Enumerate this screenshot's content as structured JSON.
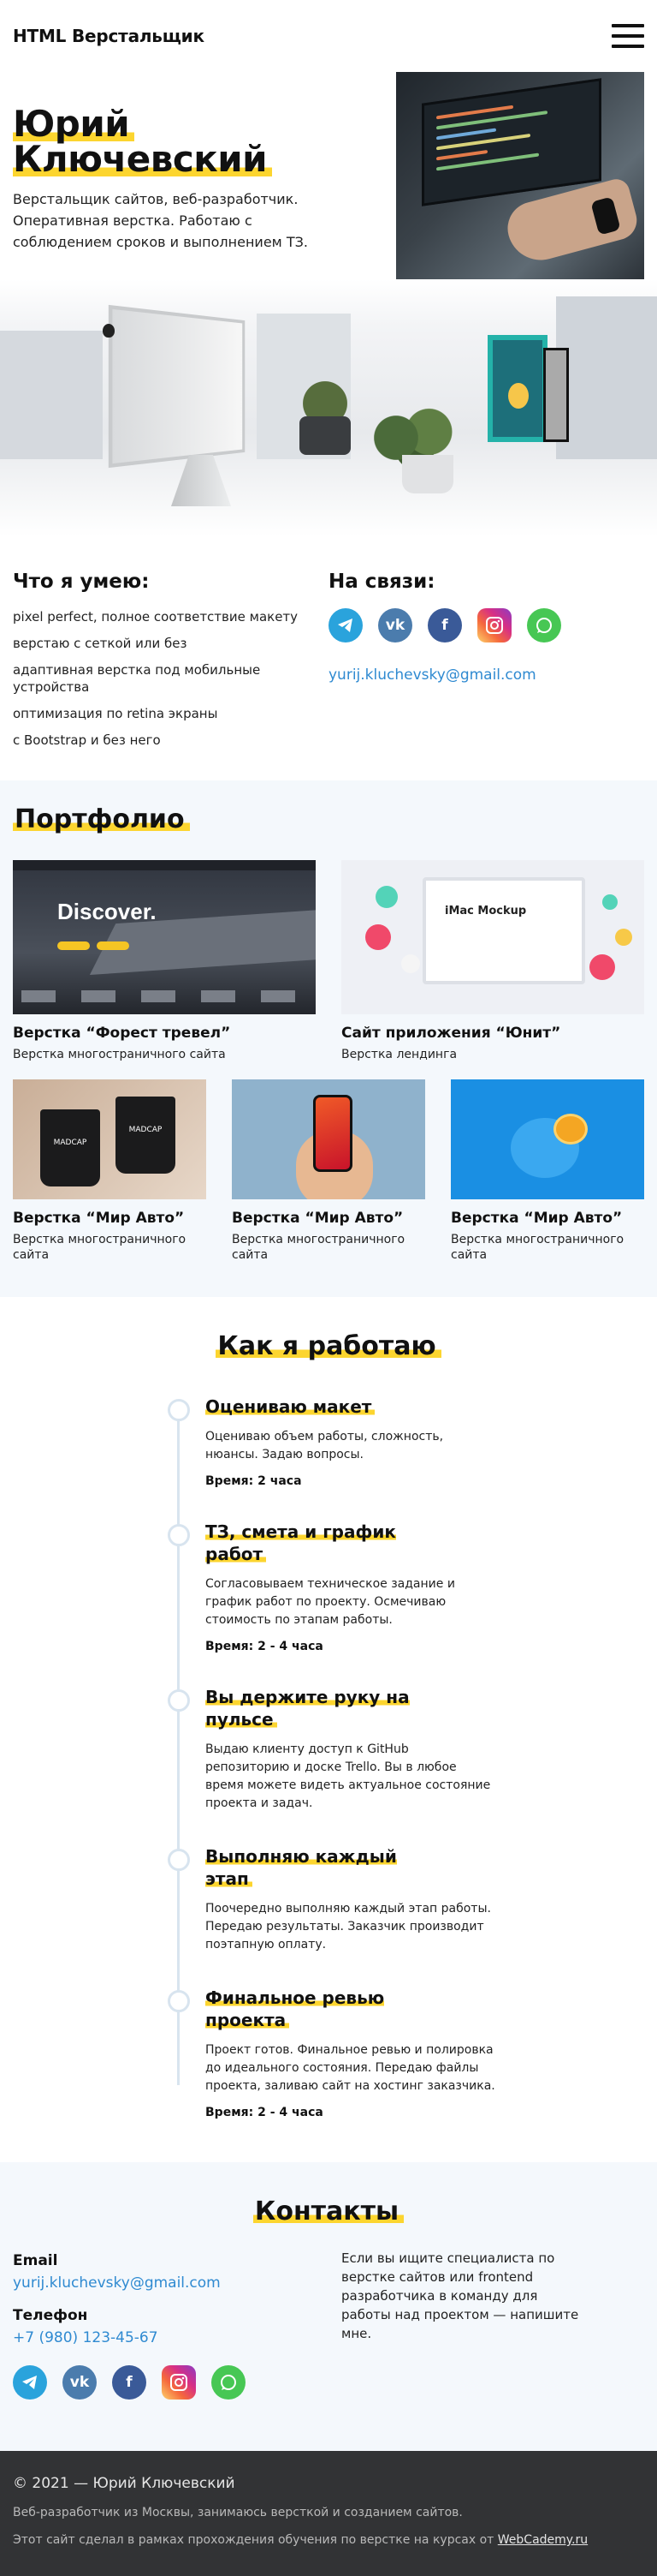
{
  "header": {
    "logo": "HTML Верстальщик",
    "menu_icon": "burger-menu-icon"
  },
  "hero": {
    "name_line1": "Юрий",
    "name_line2": "Ключевский",
    "description": "Верстальщик сайтов, веб-разработчик. Оперативная верстка. Работаю с соблюдением сроков и выполнением ТЗ."
  },
  "skills": {
    "title": "Что я умею:",
    "items": [
      "pixel perfect, полное соответствие макету",
      "верстаю с сеткой или без",
      "адаптивная верстка под мобильные устройства",
      "оптимизация по retina экраны",
      "с Bootstrap и без него"
    ]
  },
  "contact_top": {
    "title": "На связи:",
    "icons": [
      "telegram-icon",
      "vk-icon",
      "facebook-icon",
      "instagram-icon",
      "whatsapp-icon"
    ],
    "email": "yurij.kluchevsky@gmail.com"
  },
  "portfolio": {
    "title": "Портфолио",
    "items": [
      {
        "title": "Верстка “Форест тревел”",
        "desc": "Верстка многостраничного сайта",
        "image_text": "Discover."
      },
      {
        "title": "Сайт приложения “Юнит”",
        "desc": "Верстка лендинга",
        "image_text": "iMac Mockup"
      },
      {
        "title": "Верстка “Мир Авто”",
        "desc": "Верстка многостраничного сайта",
        "image_text": "MADCAP"
      },
      {
        "title": "Верстка “Мир Авто”",
        "desc": "Верстка многостраничного сайта"
      },
      {
        "title": "Верстка “Мир Авто”",
        "desc": "Верстка многостраничного сайта"
      }
    ]
  },
  "work": {
    "title": "Как я работаю",
    "steps": [
      {
        "title": "Оцениваю макет",
        "text": "Оцениваю объем работы, сложность, нюансы. Задаю вопросы.",
        "time": "Время: 2 часа"
      },
      {
        "title": "ТЗ, смета и график работ",
        "text": "Согласовываем техническое задание и график работ по проекту. Осмечиваю стоимость по этапам работы.",
        "time": "Время: 2 - 4 часа"
      },
      {
        "title": "Вы держите руку на пульсе",
        "text": "Выдаю клиенту доступ к GitHub репозиторию и доске Trello. Вы в любое время можете видеть актуальное состояние проекта и задач.",
        "time": ""
      },
      {
        "title": "Выполняю каждый этап",
        "text": "Поочередно выполняю каждый этап работы. Передаю результаты. Заказчик производит поэтапную оплату.",
        "time": ""
      },
      {
        "title": "Финальное ревью проекта",
        "text": "Проект готов. Финальное ревью и полировка до идеального состояния. Передаю файлы проекта, заливаю сайт на хостинг заказчика.",
        "time": "Время: 2 - 4 часа"
      }
    ]
  },
  "contacts": {
    "title": "Контакты",
    "email_label": "Email",
    "email": "yurij.kluchevsky@gmail.com",
    "phone_label": "Телефон",
    "phone": "+7 (980) 123-45-67",
    "note": "Если вы ищите специалиста по верстке сайтов или frontend разработчика в команду для работы над проектом — напишите мне.",
    "icons": [
      "telegram-icon",
      "vk-icon",
      "facebook-icon",
      "instagram-icon",
      "whatsapp-icon"
    ]
  },
  "footer": {
    "copyright": "© 2021 — Юрий Ключевский",
    "about": "Веб-разработчик из Москвы, занимаюсь версткой и созданием сайтов.",
    "course_text": "Этот сайт сделал в рамках прохождения обучения по верстке на курсах от",
    "course_link": "WebCademy.ru"
  },
  "colors": {
    "accent": "#fcd52f",
    "link": "#2f8ad1",
    "footer_bg": "#323335",
    "light_bg": "#f4f8fc"
  }
}
